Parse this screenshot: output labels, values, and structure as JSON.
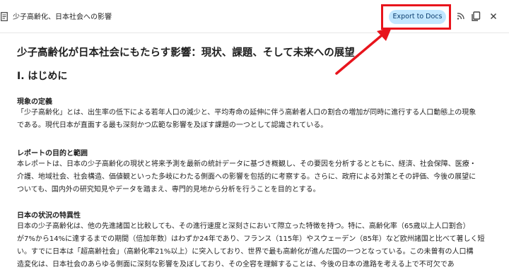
{
  "header": {
    "title": "少子高齢化、日本社会への影響",
    "export_label": "Export to Docs",
    "accent_color": "#c2e7ff",
    "highlight_color": "#e8141c"
  },
  "icons": [
    "document-icon",
    "cast-icon",
    "copy-icon",
    "close-icon"
  ],
  "document": {
    "title": "少子高齢化が日本社会にもたらす影響：現状、課題、そして未来への展望",
    "section1": {
      "heading": "I. はじめに",
      "sub1": {
        "heading": "現象の定義",
        "lines": [
          "「少子高齢化」とは、出生率の低下による若年人口の減少と、平均寿命の延伸に伴う高齢者人口の割合の増加が同時に進行する人口動態上の現象",
          "である。現代日本が直面する最も深刻かつ広範な影響を及ぼす課題の一つとして認識されている。"
        ]
      },
      "sub2": {
        "heading": "レポートの目的と範囲",
        "lines": [
          "本レポートは、日本の少子高齢化の現状と将来予測を最新の統計データに基づき概観し、その要因を分析するとともに、経済、社会保障、医療・",
          "介護、地域社会、社会構造、価値観といった多岐にわたる側面への影響を包括的に考察する。さらに、政府による対策とその評価、今後の展望に",
          "ついても、国内外の研究知見やデータを踏まえ、専門的見地から分析を行うことを目的とする。"
        ]
      },
      "sub3": {
        "heading": "日本の状況の特異性",
        "lines": [
          "日本の少子高齢化は、他の先進諸国と比較しても、その進行速度と深刻さにおいて際立った特徴を持つ。特に、高齢化率（65歳以上人口割合）",
          "が7%から14%に達するまでの期間（倍加年数）はわずか24年であり、フランス（115年）やスウェーデン（85年）など欧州諸国と比べて著しく短",
          "い。すでに日本は「超高齢社会」（高齢化率21%以上）に突入しており、世界で最も高齢化が進んだ国の一つとなっている。この未曾有の人口構",
          "造変化は、日本社会のあらゆる側面に深刻な影響を及ぼしており、その全容を理解することは、今後の日本の進路を考える上で不可欠であ"
        ]
      }
    }
  }
}
